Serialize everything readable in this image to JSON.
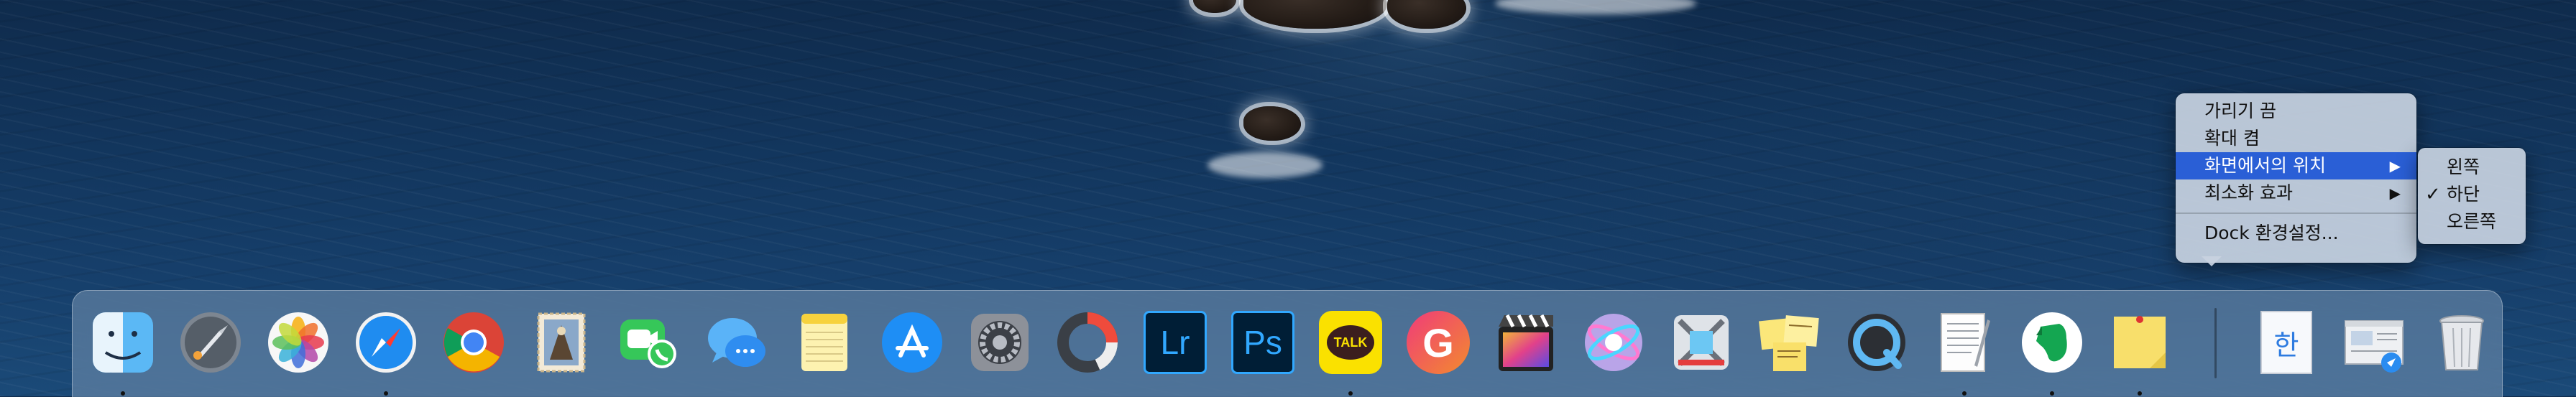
{
  "desktop": {
    "wallpaper": "catalina-island-ocean"
  },
  "context_menu": {
    "items": [
      {
        "label": "가리기 끔",
        "has_submenu": false,
        "selected": false
      },
      {
        "label": "확대 켬",
        "has_submenu": false,
        "selected": false
      },
      {
        "label": "화면에서의 위치",
        "has_submenu": true,
        "selected": true
      },
      {
        "label": "최소화 효과",
        "has_submenu": true,
        "selected": false
      }
    ],
    "footer": {
      "label": "Dock 환경설정..."
    }
  },
  "submenu": {
    "items": [
      {
        "label": "왼쪽",
        "checked": false
      },
      {
        "label": "하단",
        "checked": true
      },
      {
        "label": "오른쪽",
        "checked": false
      }
    ],
    "check_glyph": "✓"
  },
  "dock": {
    "items": [
      {
        "name": "finder-icon",
        "running": true
      },
      {
        "name": "launchpad-icon",
        "running": false
      },
      {
        "name": "photos-icon",
        "running": false
      },
      {
        "name": "safari-icon",
        "running": true
      },
      {
        "name": "chrome-icon",
        "running": false
      },
      {
        "name": "mail-icon",
        "running": false
      },
      {
        "name": "facetime-icon",
        "running": false
      },
      {
        "name": "messages-icon",
        "running": false
      },
      {
        "name": "notes-icon",
        "running": false
      },
      {
        "name": "app-store-icon",
        "running": false
      },
      {
        "name": "system-preferences-icon",
        "running": false
      },
      {
        "name": "istat-menus-icon",
        "running": false
      },
      {
        "name": "lightroom-icon",
        "running": false
      },
      {
        "name": "photoshop-icon",
        "running": false
      },
      {
        "name": "kakaotalk-icon",
        "running": true
      },
      {
        "name": "grammarly-icon",
        "running": false
      },
      {
        "name": "final-cut-pro-icon",
        "running": false
      },
      {
        "name": "motion-icon",
        "running": false
      },
      {
        "name": "compressor-icon",
        "running": false
      },
      {
        "name": "stickies-icon",
        "running": false
      },
      {
        "name": "quicktime-icon",
        "running": false
      },
      {
        "name": "textedit-icon",
        "running": true
      },
      {
        "name": "evernote-icon",
        "running": true
      },
      {
        "name": "sticky-note-icon",
        "running": true
      },
      {
        "name": "hancom-document-icon",
        "running": false
      },
      {
        "name": "preview-window-icon",
        "running": false
      },
      {
        "name": "trash-icon",
        "running": false
      }
    ],
    "labels": {
      "lightroom": "Lr",
      "photoshop": "Ps",
      "kakaotalk": "TALK",
      "grammarly": "G",
      "hancom": "한"
    },
    "colors": {
      "menu_highlight": "#2a5fd6",
      "lightroom": "#31a8ff",
      "photoshop": "#31a8ff",
      "kakao": "#fae100"
    }
  }
}
